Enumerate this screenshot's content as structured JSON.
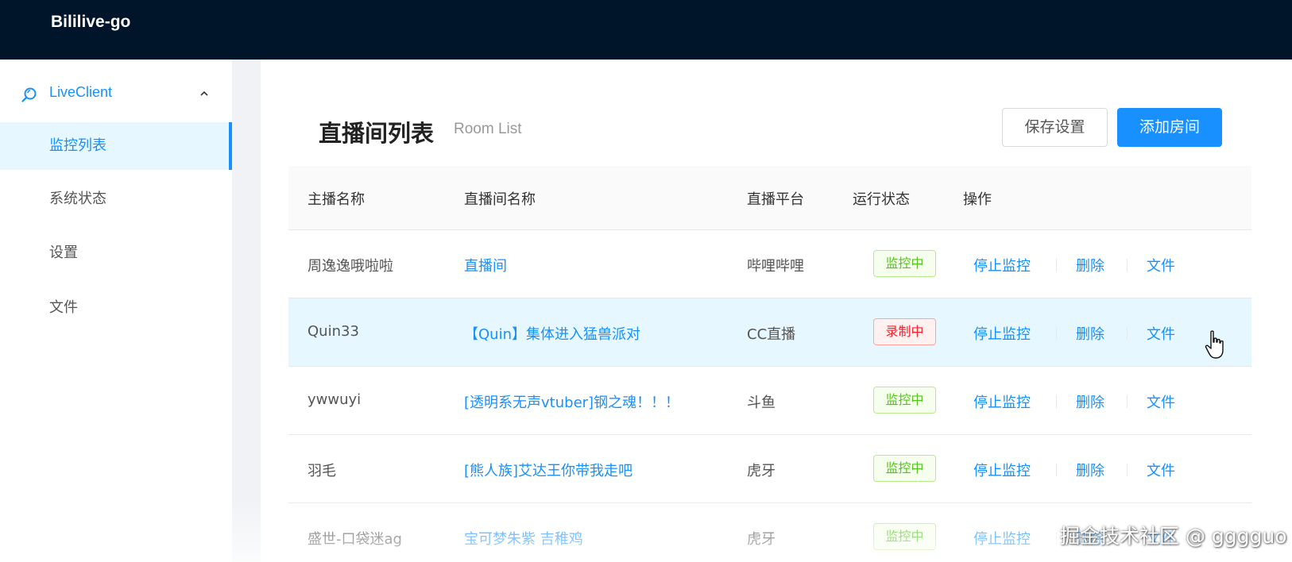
{
  "app": {
    "brand": "Bililive-go"
  },
  "sidebar": {
    "group_label": "LiveClient",
    "items": [
      {
        "label": "监控列表",
        "active": true
      },
      {
        "label": "系统状态",
        "active": false
      },
      {
        "label": "设置",
        "active": false
      },
      {
        "label": "文件",
        "active": false
      }
    ]
  },
  "page": {
    "title": "直播间列表",
    "subtitle": "Room List",
    "save_button": "保存设置",
    "add_button": "添加房间"
  },
  "table": {
    "columns": [
      "主播名称",
      "直播间名称",
      "直播平台",
      "运行状态",
      "操作"
    ],
    "rows": [
      {
        "host": "周逸逸哦啦啦",
        "room": "直播间",
        "platform": "哔哩哔哩",
        "status": "监控中",
        "status_color": "green"
      },
      {
        "host": "Quin33",
        "room": "【Quin】集体进入猛兽派对",
        "platform": "CC直播",
        "status": "录制中",
        "status_color": "red"
      },
      {
        "host": "ywwuyi",
        "room": "[透明系无声vtuber]钢之魂！！！",
        "platform": "斗鱼",
        "status": "监控中",
        "status_color": "green"
      },
      {
        "host": "羽毛",
        "room": "[熊人族]艾达王你带我走吧",
        "platform": "虎牙",
        "status": "监控中",
        "status_color": "green"
      },
      {
        "host": "盛世-口袋迷ag",
        "room": "宝可梦朱紫 吉稚鸡",
        "platform": "虎牙",
        "status": "监控中",
        "status_color": "green"
      }
    ],
    "actions": {
      "stop": "停止监控",
      "delete": "删除",
      "files": "文件"
    }
  },
  "colors": {
    "header_bg": "#001529",
    "primary": "#1890ff",
    "tag_green": "#52c41a",
    "tag_red": "#f5222d"
  },
  "watermark": "掘金技术社区 @ gggguo"
}
